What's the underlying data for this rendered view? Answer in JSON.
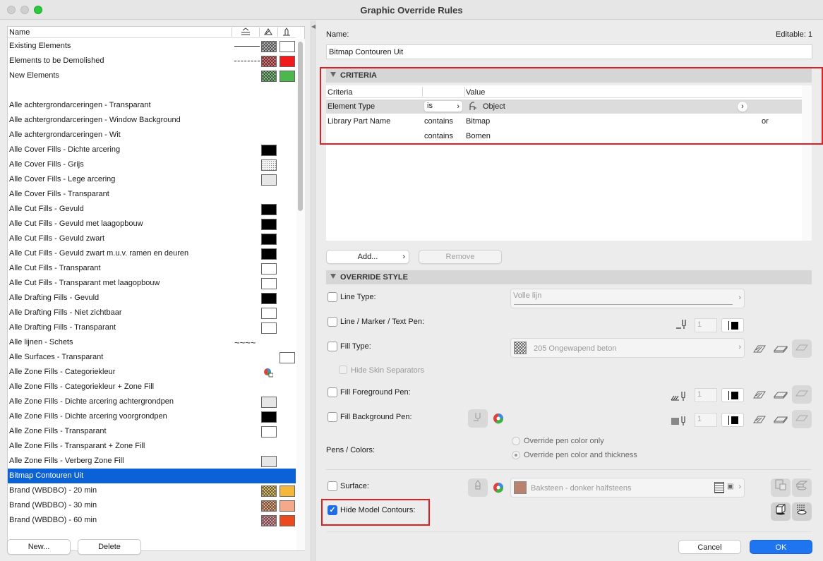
{
  "window": {
    "title": "Graphic Override Rules"
  },
  "list": {
    "header": {
      "name": "Name"
    },
    "rows": [
      {
        "label": "Existing Elements"
      },
      {
        "label": "Elements to be Demolished"
      },
      {
        "label": "New Elements"
      },
      {
        "label": ""
      },
      {
        "label": "Alle achtergrondarceringen - Transparant"
      },
      {
        "label": "Alle achtergrondarceringen - Window Background"
      },
      {
        "label": "Alle achtergrondarceringen - Wit"
      },
      {
        "label": "Alle Cover Fills - Dichte arcering"
      },
      {
        "label": "Alle Cover Fills - Grijs"
      },
      {
        "label": "Alle Cover Fills - Lege arcering"
      },
      {
        "label": "Alle Cover Fills - Transparant"
      },
      {
        "label": "Alle Cut Fills - Gevuld"
      },
      {
        "label": "Alle Cut Fills - Gevuld met laagopbouw"
      },
      {
        "label": "Alle Cut Fills - Gevuld zwart"
      },
      {
        "label": "Alle Cut Fills - Gevuld zwart m.u.v. ramen en deuren"
      },
      {
        "label": "Alle Cut Fills - Transparant"
      },
      {
        "label": "Alle Cut Fills - Transparant met laagopbouw"
      },
      {
        "label": "Alle Drafting Fills - Gevuld"
      },
      {
        "label": "Alle Drafting Fills - Niet zichtbaar"
      },
      {
        "label": "Alle Drafting Fills - Transparant"
      },
      {
        "label": "Alle lijnen - Schets"
      },
      {
        "label": "Alle Surfaces - Transparant"
      },
      {
        "label": "Alle Zone Fills - Categoriekleur"
      },
      {
        "label": "Alle Zone Fills - Categoriekleur + Zone Fill"
      },
      {
        "label": "Alle Zone Fills - Dichte arcering achtergrondpen"
      },
      {
        "label": "Alle Zone Fills - Dichte arcering voorgrondpen"
      },
      {
        "label": "Alle Zone Fills - Transparant"
      },
      {
        "label": "Alle Zone Fills - Transparant + Zone Fill"
      },
      {
        "label": "Alle Zone Fills - Verberg Zone Fill"
      },
      {
        "label": "Bitmap Contouren Uit"
      },
      {
        "label": "Brand (WBDBO) -  20 min"
      },
      {
        "label": "Brand (WBDBO) -  30 min"
      },
      {
        "label": "Brand (WBDBO) -  60 min"
      }
    ],
    "colors": {
      "red": "#f01c1c",
      "green": "#4cb84c",
      "selection": "#0b62d6",
      "orange1": "#f5b63a",
      "orange2": "#f5a98a",
      "orange3": "#ec4a1e"
    },
    "new_button": "New...",
    "delete_button": "Delete"
  },
  "editor": {
    "name_label": "Name:",
    "editable": "Editable: 1",
    "name_value": "Bitmap Contouren Uit",
    "criteria": {
      "title": "CRITERIA",
      "col_criteria": "Criteria",
      "col_value": "Value",
      "rows": [
        {
          "criteria": "Element Type",
          "op": "is",
          "value": "Object",
          "extra": ""
        },
        {
          "criteria": "Library Part Name",
          "op": "contains",
          "value": "Bitmap",
          "extra": "or"
        },
        {
          "criteria": "",
          "op": "contains",
          "value": "Bomen",
          "extra": ""
        }
      ],
      "add_button": "Add...",
      "remove_button": "Remove"
    },
    "override": {
      "title": "OVERRIDE STYLE",
      "line_type": "Line Type:",
      "line_type_value": "Volle lijn",
      "line_pen": "Line / Marker / Text Pen:",
      "pen_number": "1",
      "fill_type": "Fill Type:",
      "fill_type_value": "205 Ongewapend beton",
      "hide_skin": "Hide Skin Separators",
      "fill_fg": "Fill Foreground Pen:",
      "fill_bg": "Fill Background Pen:",
      "pens_colors": "Pens / Colors:",
      "radio1": "Override pen color only",
      "radio2": "Override pen color and thickness",
      "surface": "Surface:",
      "surface_value": "Baksteen - donker halfsteens",
      "surface_color": "#b8826e",
      "hide_contours": "Hide Model Contours:"
    },
    "cancel_button": "Cancel",
    "ok_button": "OK"
  }
}
